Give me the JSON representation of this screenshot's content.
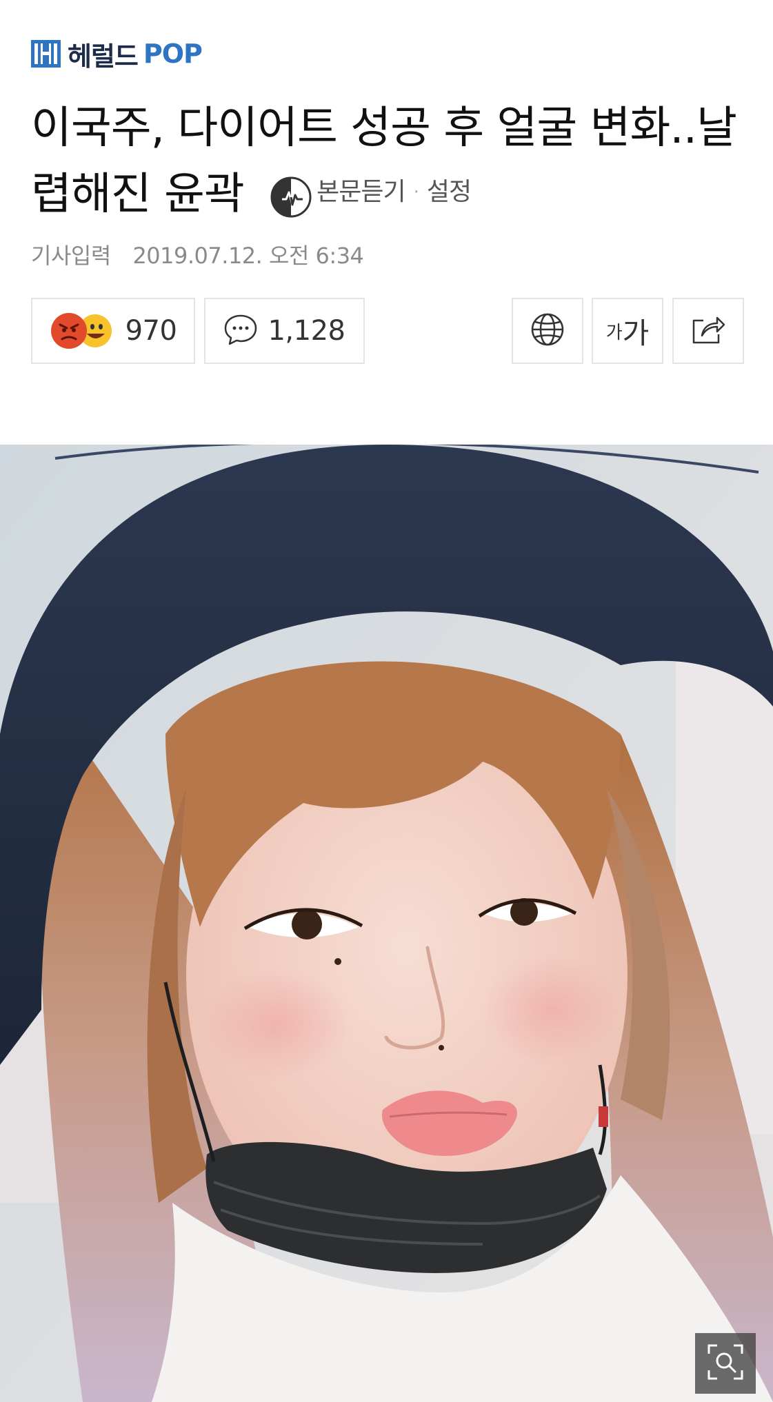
{
  "brand": {
    "name_korean": "헤럴드",
    "name_pop": "POP"
  },
  "article": {
    "headline": "이국주, 다이어트 성공 후 얼굴 변화..날렵해진 윤곽",
    "listen_label": "본문듣기",
    "separator": "·",
    "settings_label": "설정",
    "date_label": "기사입력",
    "date_value": "2019.07.12. 오전 6:34"
  },
  "toolbar": {
    "reaction_count": "970",
    "comment_count": "1,128",
    "font_small": "가",
    "font_large": "가"
  },
  "icons": {
    "reaction": "angry-and-laughing-emoji-icons",
    "comment": "speech-bubble-icon",
    "globe": "globe-icon",
    "share": "share-icon",
    "listen": "audio-play-icon",
    "zoom": "zoom-icon"
  },
  "colors": {
    "brand_dark": "#1c2b4a",
    "brand_blue": "#2e74c2",
    "meta_gray": "#8a8a8a",
    "border": "#e4e4e4"
  }
}
